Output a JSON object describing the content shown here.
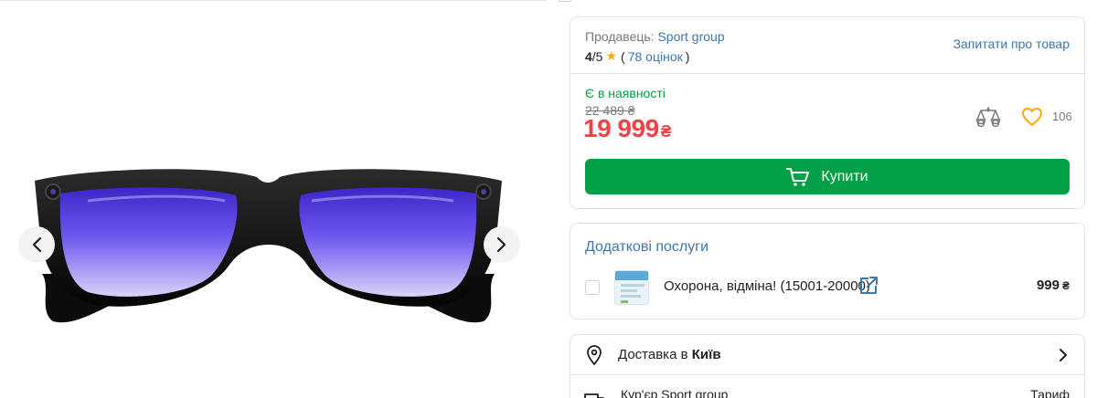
{
  "gallery": {
    "image_alt": "Ray-Ban Meta smart glasses",
    "prev_icon": "chevron-left-icon",
    "next_icon": "chevron-right-icon"
  },
  "seller": {
    "label": "Продавець:",
    "name": "Sport group",
    "rating_value": "4",
    "rating_max": "/5",
    "reviews_open": "(",
    "reviews_link": "78 оцінок",
    "reviews_close": ")",
    "ask_link": "Запитати про товар"
  },
  "offer": {
    "availability": "Є в наявності",
    "old_price": "22 489 ₴",
    "price": "19 999",
    "currency": "₴",
    "favorites_count": "106",
    "buy_label": "Купити"
  },
  "services": {
    "title": "Додаткові послуги",
    "items": [
      {
        "name": "Охорона, відміна! (15001-20000)",
        "price": "999",
        "currency": "₴",
        "checked": false
      }
    ]
  },
  "delivery": {
    "prefix": "Доставка в",
    "city": "Київ",
    "courier": "Кур'єр Sport group",
    "tariff_label": "Тариф"
  },
  "colors": {
    "accent_green": "#00a046",
    "price_red": "#f84147",
    "link_blue": "#3e77aa",
    "star_orange": "#ffa900"
  }
}
